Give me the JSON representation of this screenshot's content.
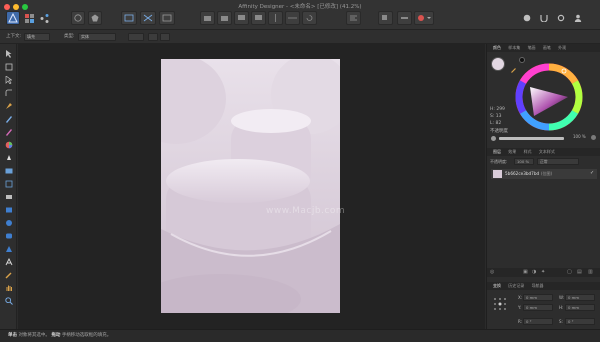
{
  "window": {
    "title": "Affinity Designer - <未命名> [已修改] (41.2%)"
  },
  "context_toolbar": {
    "label_1": "上下文:",
    "value_1": "填充",
    "label_2": "类型:",
    "value_2": "实体"
  },
  "color_panel": {
    "tabs": [
      "颜色",
      "样本集",
      "笔画",
      "画笔",
      "外观"
    ],
    "h_label": "H: 299",
    "s_label": "S: 13",
    "l_label": "L: 82",
    "opacity_label": "不透明度",
    "opacity_value": "100 %",
    "fill_color": "#e2d7e2"
  },
  "layers_panel": {
    "tabs": [
      "图层",
      "效果",
      "样式",
      "文本样式"
    ],
    "opacity_label": "不透明度:",
    "opacity_value": "100 %",
    "blend_mode": "正常",
    "layer_name": "5b662ce3bd7bd",
    "layer_type": "(位图)"
  },
  "transform_panel": {
    "tabs": [
      "变换",
      "历史记录",
      "导航器"
    ],
    "x_label": "X:",
    "x_value": "0 mm",
    "y_label": "Y:",
    "y_value": "0 mm",
    "w_label": "W:",
    "w_value": "0 mm",
    "h_label": "H:",
    "h_value": "0 mm",
    "r_label": "R:",
    "r_value": "0 °",
    "s_label": "S:",
    "s_value": "0 °"
  },
  "status": {
    "bold_1": "单击",
    "text_1": "对象将其选中。",
    "bold_2": "拖动",
    "text_2": "手柄移动选取框的填充。"
  },
  "watermark": "www.Macjb.com"
}
